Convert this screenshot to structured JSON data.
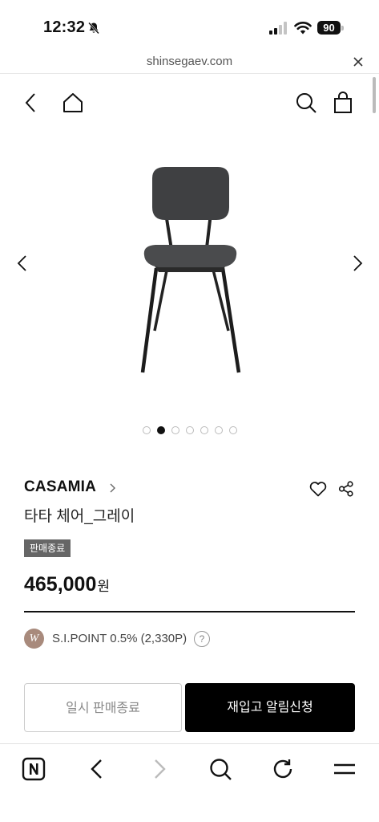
{
  "status_bar": {
    "time": "12:32",
    "battery": "90",
    "icons": [
      "bell-slash-icon",
      "signal-icon",
      "wifi-icon",
      "battery-icon"
    ]
  },
  "url_bar": {
    "url": "shinsegaev.com",
    "close_icon": "close-icon"
  },
  "header": {
    "icons": [
      "back-icon",
      "home-icon",
      "search-icon",
      "cart-icon"
    ]
  },
  "gallery": {
    "image": "chair-image",
    "dot_count": 7,
    "active_dot": 2
  },
  "product": {
    "brand": "CASAMIA",
    "name": "타타 체어_그레이",
    "status_badge": "판매종료",
    "price": "465,000",
    "currency": "원",
    "point_logo": "W",
    "point_text": "S.I.POINT 0.5% (2,330P)",
    "help_label": "?"
  },
  "actions": {
    "sold_out_label": "일시 판매종료",
    "restock_label": "재입고 알림신청"
  },
  "toolbar": {
    "icons": [
      "naver-n-icon",
      "back-icon",
      "forward-icon",
      "search-icon",
      "refresh-icon",
      "menu-icon"
    ]
  },
  "colors": {
    "badge_bg": "#666666",
    "point_logo_bg": "#a88a7c",
    "primary_button": "#000000"
  }
}
